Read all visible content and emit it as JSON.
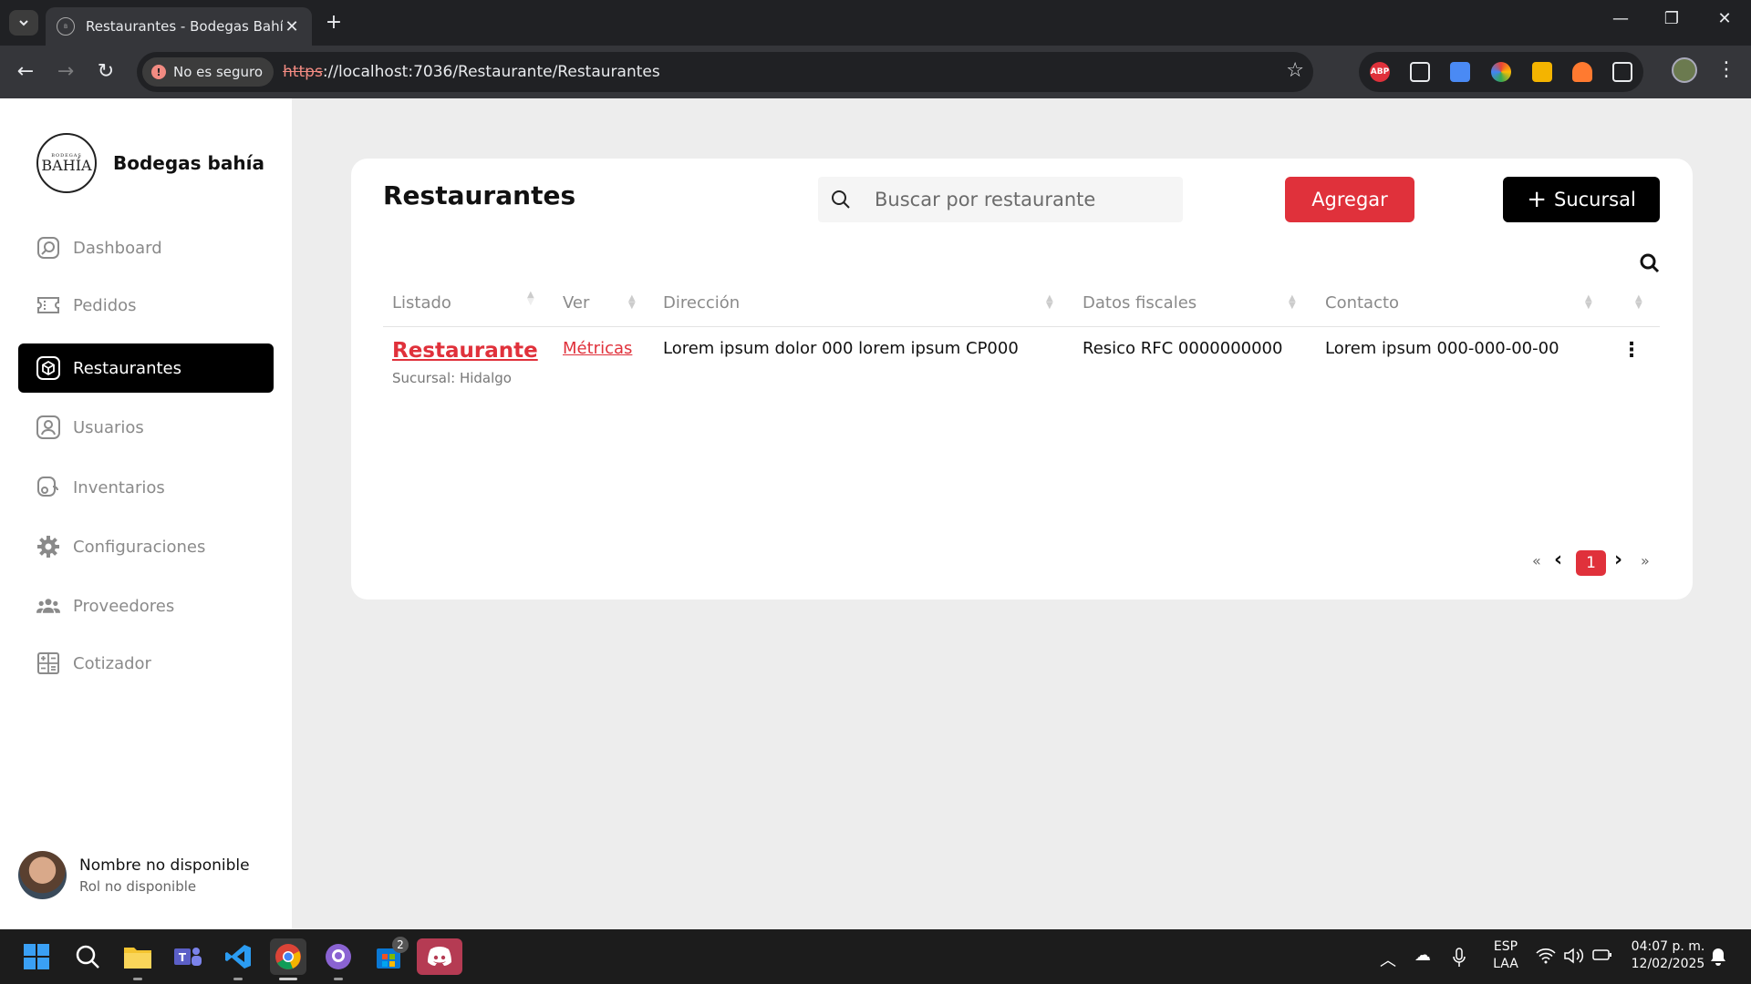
{
  "browser": {
    "tab_title": "Restaurantes - Bodegas Bahía",
    "security_label": "No es seguro",
    "url_protocol": "https",
    "url_rest": "://localhost:7036/Restaurante/Restaurantes"
  },
  "sidebar": {
    "brand_name": "Bodegas bahía",
    "logo_small": "BODEGAS",
    "logo_big": "BAHÍA",
    "items": [
      {
        "label": "Dashboard",
        "icon": "dashboard-icon"
      },
      {
        "label": "Pedidos",
        "icon": "ticket-icon"
      },
      {
        "label": "Restaurantes",
        "icon": "box-icon",
        "active": true
      },
      {
        "label": "Usuarios",
        "icon": "user-icon"
      },
      {
        "label": "Inventarios",
        "icon": "inventory-icon"
      },
      {
        "label": "Configuraciones",
        "icon": "gear-icon"
      },
      {
        "label": "Proveedores",
        "icon": "people-icon"
      },
      {
        "label": "Cotizador",
        "icon": "calculator-icon"
      }
    ],
    "user": {
      "name": "Nombre no disponible",
      "role": "Rol no disponible"
    }
  },
  "main": {
    "title": "Restaurantes",
    "search_placeholder": "Buscar por restaurante",
    "add_label": "Agregar",
    "branch_label": "Sucursal",
    "columns": [
      "Listado",
      "Ver",
      "Dirección",
      "Datos fiscales",
      "Contacto"
    ],
    "rows": [
      {
        "name": "Restaurante",
        "branch": "Sucursal: Hidalgo",
        "view": "Métricas",
        "address": "Lorem ipsum dolor 000 lorem ipsum CP000",
        "fiscal": "Resico RFC 0000000000",
        "contact": "Lorem ipsum 000-000-00-00"
      }
    ],
    "pagination": {
      "first": "«",
      "last": "»",
      "current": "1"
    }
  },
  "taskbar": {
    "lang": "ESP",
    "layout": "LAA",
    "time": "04:07 p. m.",
    "date": "12/02/2025",
    "store_badge": "2"
  },
  "colors": {
    "accent": "#e0313b",
    "active_nav": "#000000"
  }
}
